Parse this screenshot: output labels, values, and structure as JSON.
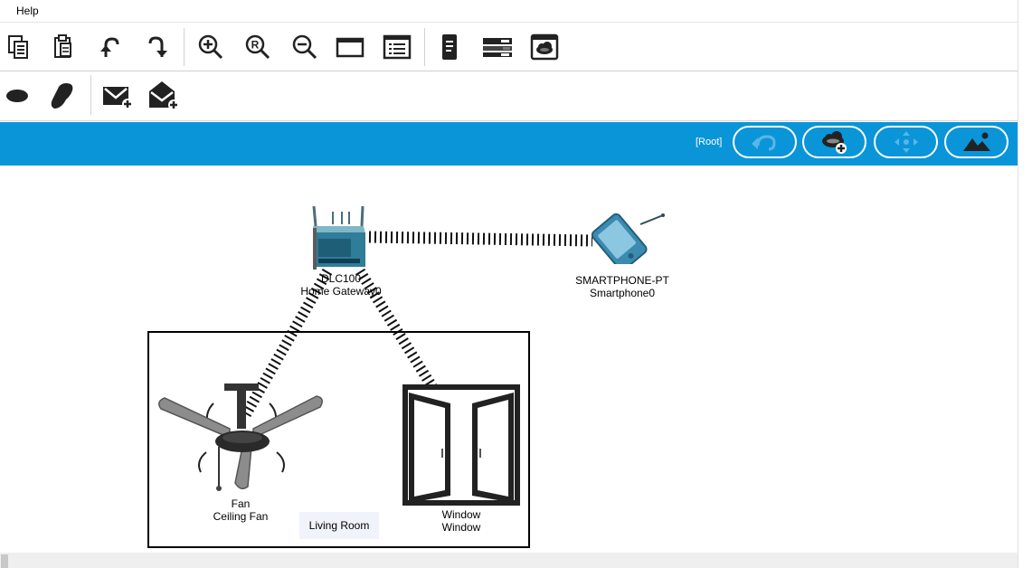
{
  "menubar": {
    "help_label": "Help"
  },
  "toolbar1": {
    "icons": [
      "copy-icon",
      "paste-icon",
      "undo-icon",
      "redo-icon",
      "zoom-in-icon",
      "zoom-reset-icon",
      "zoom-out-icon",
      "drawing-palette-icon",
      "custom-device-dialog-icon",
      "inspect-device-icon",
      "cluster-icon",
      "viewport-icon"
    ]
  },
  "toolbar2": {
    "icons": [
      "draw-ellipse-icon",
      "freeform-shape-icon",
      "simple-pdu-icon",
      "complex-pdu-icon"
    ]
  },
  "logical_bar": {
    "root_label": "[Root]",
    "buttons": [
      "back-icon",
      "new-cluster-icon",
      "move-object-icon",
      "set-tiled-background-icon"
    ],
    "color": "#0a95d8"
  },
  "workspace": {
    "devices": [
      {
        "name": "home-gateway",
        "model": "DLC100",
        "label": "Home Gateway0"
      },
      {
        "name": "smartphone",
        "model": "SMARTPHONE-PT",
        "label": "Smartphone0"
      },
      {
        "name": "fan",
        "model": "Fan",
        "label": "Ceiling Fan"
      },
      {
        "name": "window",
        "model": "Window",
        "label": "Window"
      }
    ],
    "container_label": "Living Room"
  }
}
